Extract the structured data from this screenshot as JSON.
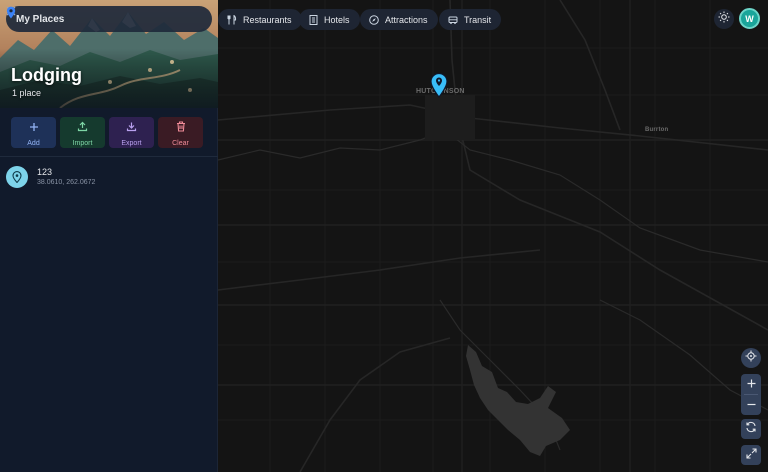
{
  "search": {
    "value": "My Places"
  },
  "hero": {
    "title": "Lodging",
    "subtitle": "1 place"
  },
  "actions": [
    {
      "label": "Add",
      "icon": "plus-icon"
    },
    {
      "label": "Import",
      "icon": "upload-icon"
    },
    {
      "label": "Export",
      "icon": "download-icon"
    },
    {
      "label": "Clear",
      "icon": "trash-icon"
    }
  ],
  "places": [
    {
      "name": "123",
      "coords": "38.0610, 262.0672",
      "icon": "map-pin-icon"
    }
  ],
  "chips": [
    {
      "label": "Restaurants",
      "icon": "utensils-icon"
    },
    {
      "label": "Hotels",
      "icon": "building-icon"
    },
    {
      "label": "Attractions",
      "icon": "compass-icon"
    },
    {
      "label": "Transit",
      "icon": "bus-icon"
    }
  ],
  "user": {
    "initial": "W"
  },
  "map": {
    "labels": [
      {
        "text": "HUTCHINSON"
      },
      {
        "text": "Burrton"
      }
    ]
  },
  "colors": {
    "sidebar_bg": "#111a2b",
    "map_bg": "#141414",
    "accent": "#1aa59a",
    "marker": "#38bdf8"
  }
}
